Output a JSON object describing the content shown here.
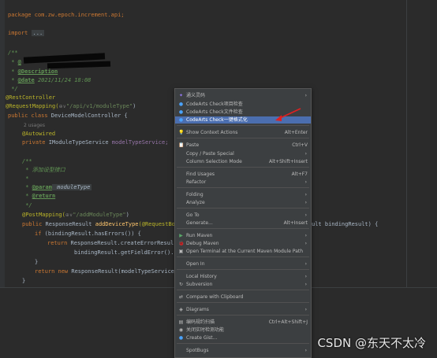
{
  "editor": {
    "line_package": "package com.zw.epoch.increment.api;",
    "import_kw": "import",
    "import_fold": "...",
    "doc_open": "/**",
    "doc_author_tag": "@",
    "doc_desc_tag": "@Description",
    "doc_date_tag": "@date",
    "doc_date_value": " 2021/11/24 18:08",
    "doc_star": " *",
    "doc_close": " */",
    "ann_rest": "@RestController",
    "ann_request": "@RequestMapping(",
    "ann_request_hint": "⊕∨",
    "ann_request_value": "\"/api/v1/moduleType\"",
    "ann_request_close": ")",
    "class_decl_kw": "public class ",
    "class_decl_name": "DeviceModelController {",
    "usages_hint": "2 usages",
    "autowired": "@Autowired",
    "field_kw": "private ",
    "field_type": "IModuleTypeService ",
    "field_name": "modelTypeService;",
    "method_doc_open": "/**",
    "method_doc_desc": " * 添加设型接口",
    "method_doc_star": " *",
    "method_doc_param_tag": "@param",
    "method_doc_param_name": " moduleType",
    "method_doc_return_tag": "@return",
    "method_doc_close": " */",
    "post_mapping": "@PostMapping(",
    "post_mapping_hint": "⊕∨",
    "post_mapping_value": "\"/addModuleType\"",
    "post_mapping_close": ")",
    "method_sig_kw": "public ",
    "method_sig_type": "ResponseResult ",
    "method_sig_name": "addDeviceType",
    "method_sig_rest": "(@RequestBo",
    "method_sig_tail": "ult bindingResult) {",
    "if_line_kw": "if ",
    "if_line_rest": "(bindingResult.hasErrors()) {",
    "return_kw": "return ",
    "return_rest": "ResponseResult.createErrorResul",
    "return_cont": "bindingResult.getFieldError().",
    "close_brace": "}",
    "final_return_kw": "return new ",
    "final_return_rest": "ResponseResult(modelTypeService",
    "class_close": "}"
  },
  "context_menu": {
    "items": [
      {
        "icon": "✦",
        "label": "通义灵码",
        "shortcut": "",
        "arrow": "›"
      },
      {
        "icon": "●",
        "label": "CodeArts Check项目检查",
        "shortcut": "",
        "arrow": ""
      },
      {
        "icon": "●",
        "label": "CodeArts Check文件检查",
        "shortcut": "",
        "arrow": ""
      },
      {
        "icon": "●",
        "label": "CodeArts Check一键格式化",
        "shortcut": "",
        "arrow": ""
      },
      {
        "icon": "💡",
        "label": "Show Context Actions",
        "shortcut": "Alt+Enter",
        "arrow": ""
      },
      {
        "icon": "📋",
        "label": "Paste",
        "shortcut": "Ctrl+V",
        "arrow": ""
      },
      {
        "icon": "",
        "label": "Copy / Paste Special",
        "shortcut": "",
        "arrow": "›"
      },
      {
        "icon": "",
        "label": "Column Selection Mode",
        "shortcut": "Alt+Shift+Insert",
        "arrow": ""
      },
      {
        "icon": "",
        "label": "Find Usages",
        "shortcut": "Alt+F7",
        "arrow": ""
      },
      {
        "icon": "",
        "label": "Refactor",
        "shortcut": "",
        "arrow": "›"
      },
      {
        "icon": "",
        "label": "Folding",
        "shortcut": "",
        "arrow": "›"
      },
      {
        "icon": "",
        "label": "Analyze",
        "shortcut": "",
        "arrow": "›"
      },
      {
        "icon": "",
        "label": "Go To",
        "shortcut": "",
        "arrow": "›"
      },
      {
        "icon": "",
        "label": "Generate...",
        "shortcut": "Alt+Insert",
        "arrow": ""
      },
      {
        "icon": "▶",
        "label": "Run Maven",
        "shortcut": "",
        "arrow": "›"
      },
      {
        "icon": "🐞",
        "label": "Debug Maven",
        "shortcut": "",
        "arrow": "›"
      },
      {
        "icon": "▣",
        "label": "Open Terminal at the Current Maven Module Path",
        "shortcut": "",
        "arrow": ""
      },
      {
        "icon": "",
        "label": "Open In",
        "shortcut": "",
        "arrow": "›"
      },
      {
        "icon": "",
        "label": "Local History",
        "shortcut": "",
        "arrow": "›"
      },
      {
        "icon": "↻",
        "label": "Subversion",
        "shortcut": "",
        "arrow": "›"
      },
      {
        "icon": "⇄",
        "label": "Compare with Clipboard",
        "shortcut": "",
        "arrow": ""
      },
      {
        "icon": "◈",
        "label": "Diagrams",
        "shortcut": "",
        "arrow": "›"
      },
      {
        "icon": "▤",
        "label": "编码规约扫描",
        "shortcut": "Ctrl+Alt+Shift+J",
        "arrow": ""
      },
      {
        "icon": "◉",
        "label": "关闭实时检测功能",
        "shortcut": "",
        "arrow": ""
      },
      {
        "icon": "●",
        "label": "Create Gist...",
        "shortcut": "",
        "arrow": ""
      },
      {
        "icon": "",
        "label": "SpotBugs",
        "shortcut": "",
        "arrow": "›"
      }
    ]
  },
  "watermark": "CSDN @东天不太冷",
  "colors": {
    "background": "#2b2b2b",
    "menu_bg": "#3c3f41",
    "selection": "#4b6eaf",
    "arrow": "#e02020"
  }
}
